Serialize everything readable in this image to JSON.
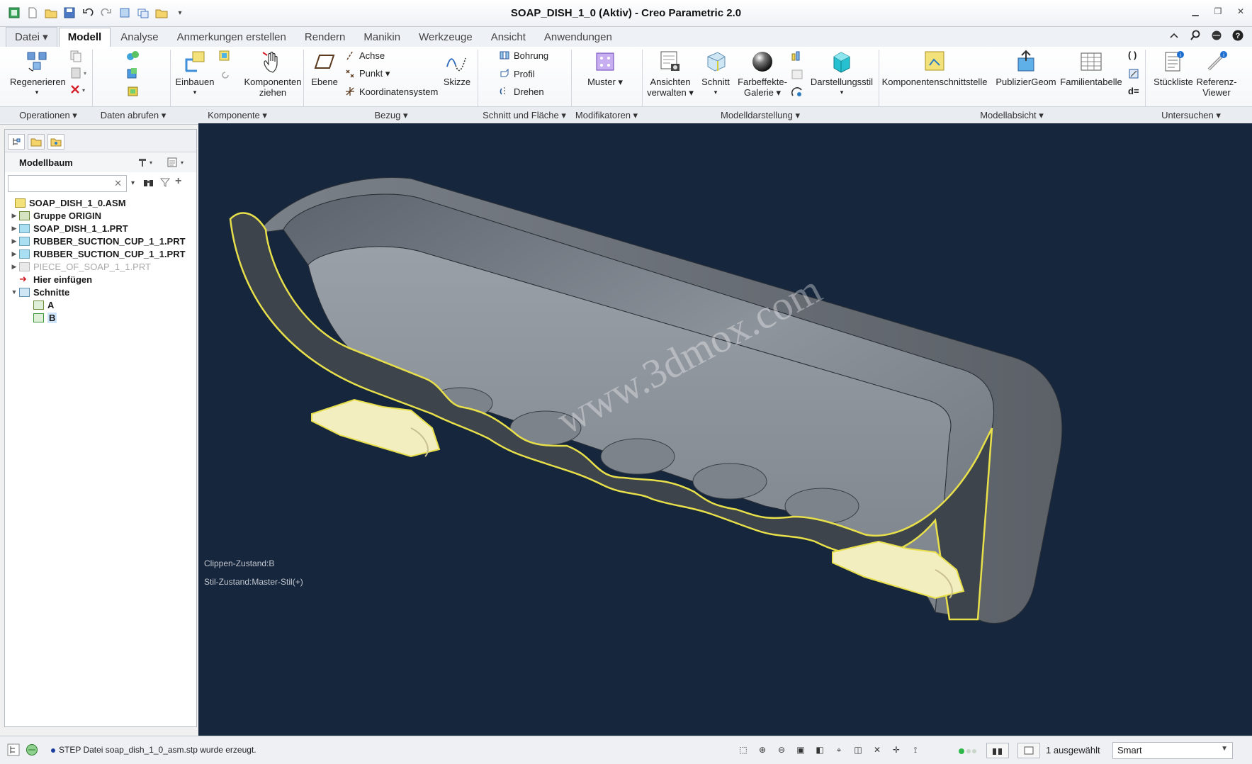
{
  "window": {
    "title": "SOAP_DISH_1_0 (Aktiv) - Creo Parametric 2.0"
  },
  "tabs": [
    {
      "label": "Datei ▾"
    },
    {
      "label": "Modell"
    },
    {
      "label": "Analyse"
    },
    {
      "label": "Anmerkungen erstellen"
    },
    {
      "label": "Rendern"
    },
    {
      "label": "Manikin"
    },
    {
      "label": "Werkzeuge"
    },
    {
      "label": "Ansicht"
    },
    {
      "label": "Anwendungen"
    }
  ],
  "ribbon": {
    "regenerieren": "Regenerieren",
    "einbauen": "Einbauen",
    "komponenten_ziehen_1": "Komponenten",
    "komponenten_ziehen_2": "ziehen",
    "ebene": "Ebene",
    "achse": "Achse",
    "punkt": "Punkt ▾",
    "koordinatensystem": "Koordinatensystem",
    "skizze": "Skizze",
    "bohrung": "Bohrung",
    "profil": "Profil",
    "drehen": "Drehen",
    "muster": "Muster ▾",
    "ansichten_verwalten_1": "Ansichten",
    "ansichten_verwalten_2": "verwalten ▾",
    "schnitt": "Schnitt",
    "farbeffekte_1": "Farbeffekte-",
    "farbeffekte_2": "Galerie ▾",
    "darstellungsstil": "Darstellungsstil",
    "komponentenschnittstelle": "Komponentenschnittstelle",
    "publiziergeom": "PublizierGeom",
    "familientabelle": "Familientabelle",
    "stueckliste": "Stückliste",
    "referenz_viewer_1": "Referenz-",
    "referenz_viewer_2": "Viewer"
  },
  "groups": [
    {
      "label": "Operationen ▾"
    },
    {
      "label": "Daten abrufen ▾"
    },
    {
      "label": "Komponente ▾"
    },
    {
      "label": "Bezug ▾"
    },
    {
      "label": "Schnitt und Fläche ▾"
    },
    {
      "label": "Modifikatoren ▾"
    },
    {
      "label": "Modelldarstellung ▾"
    },
    {
      "label": "Modellabsicht ▾"
    },
    {
      "label": "Untersuchen ▾"
    }
  ],
  "model_tree": {
    "title": "Modellbaum",
    "search_placeholder": "",
    "items": [
      {
        "label": "SOAP_DISH_1_0.ASM"
      },
      {
        "label": "Gruppe ORIGIN"
      },
      {
        "label": "SOAP_DISH_1_1.PRT"
      },
      {
        "label": "RUBBER_SUCTION_CUP_1_1.PRT"
      },
      {
        "label": "RUBBER_SUCTION_CUP_1_1.PRT"
      },
      {
        "label": "PIECE_OF_SOAP_1_1.PRT"
      },
      {
        "label": "Hier einfügen"
      },
      {
        "label": "Schnitte"
      },
      {
        "label": "A"
      },
      {
        "label": "B"
      }
    ]
  },
  "viewport": {
    "clip_state": "Clippen-Zustand:B",
    "style_state": "Stil-Zustand:Master-Stil(+)",
    "watermark": "www.3dmox.com"
  },
  "status": {
    "message": "STEP Datei soap_dish_1_0_asm.stp wurde erzeugt.",
    "selected": "1 ausgewählt",
    "filter": "Smart"
  },
  "colors": {
    "viewport_bg": "#15263d",
    "section_edge": "#e8e04a",
    "section_fill": "#f2eec0",
    "model_gray": "#8a9099"
  }
}
